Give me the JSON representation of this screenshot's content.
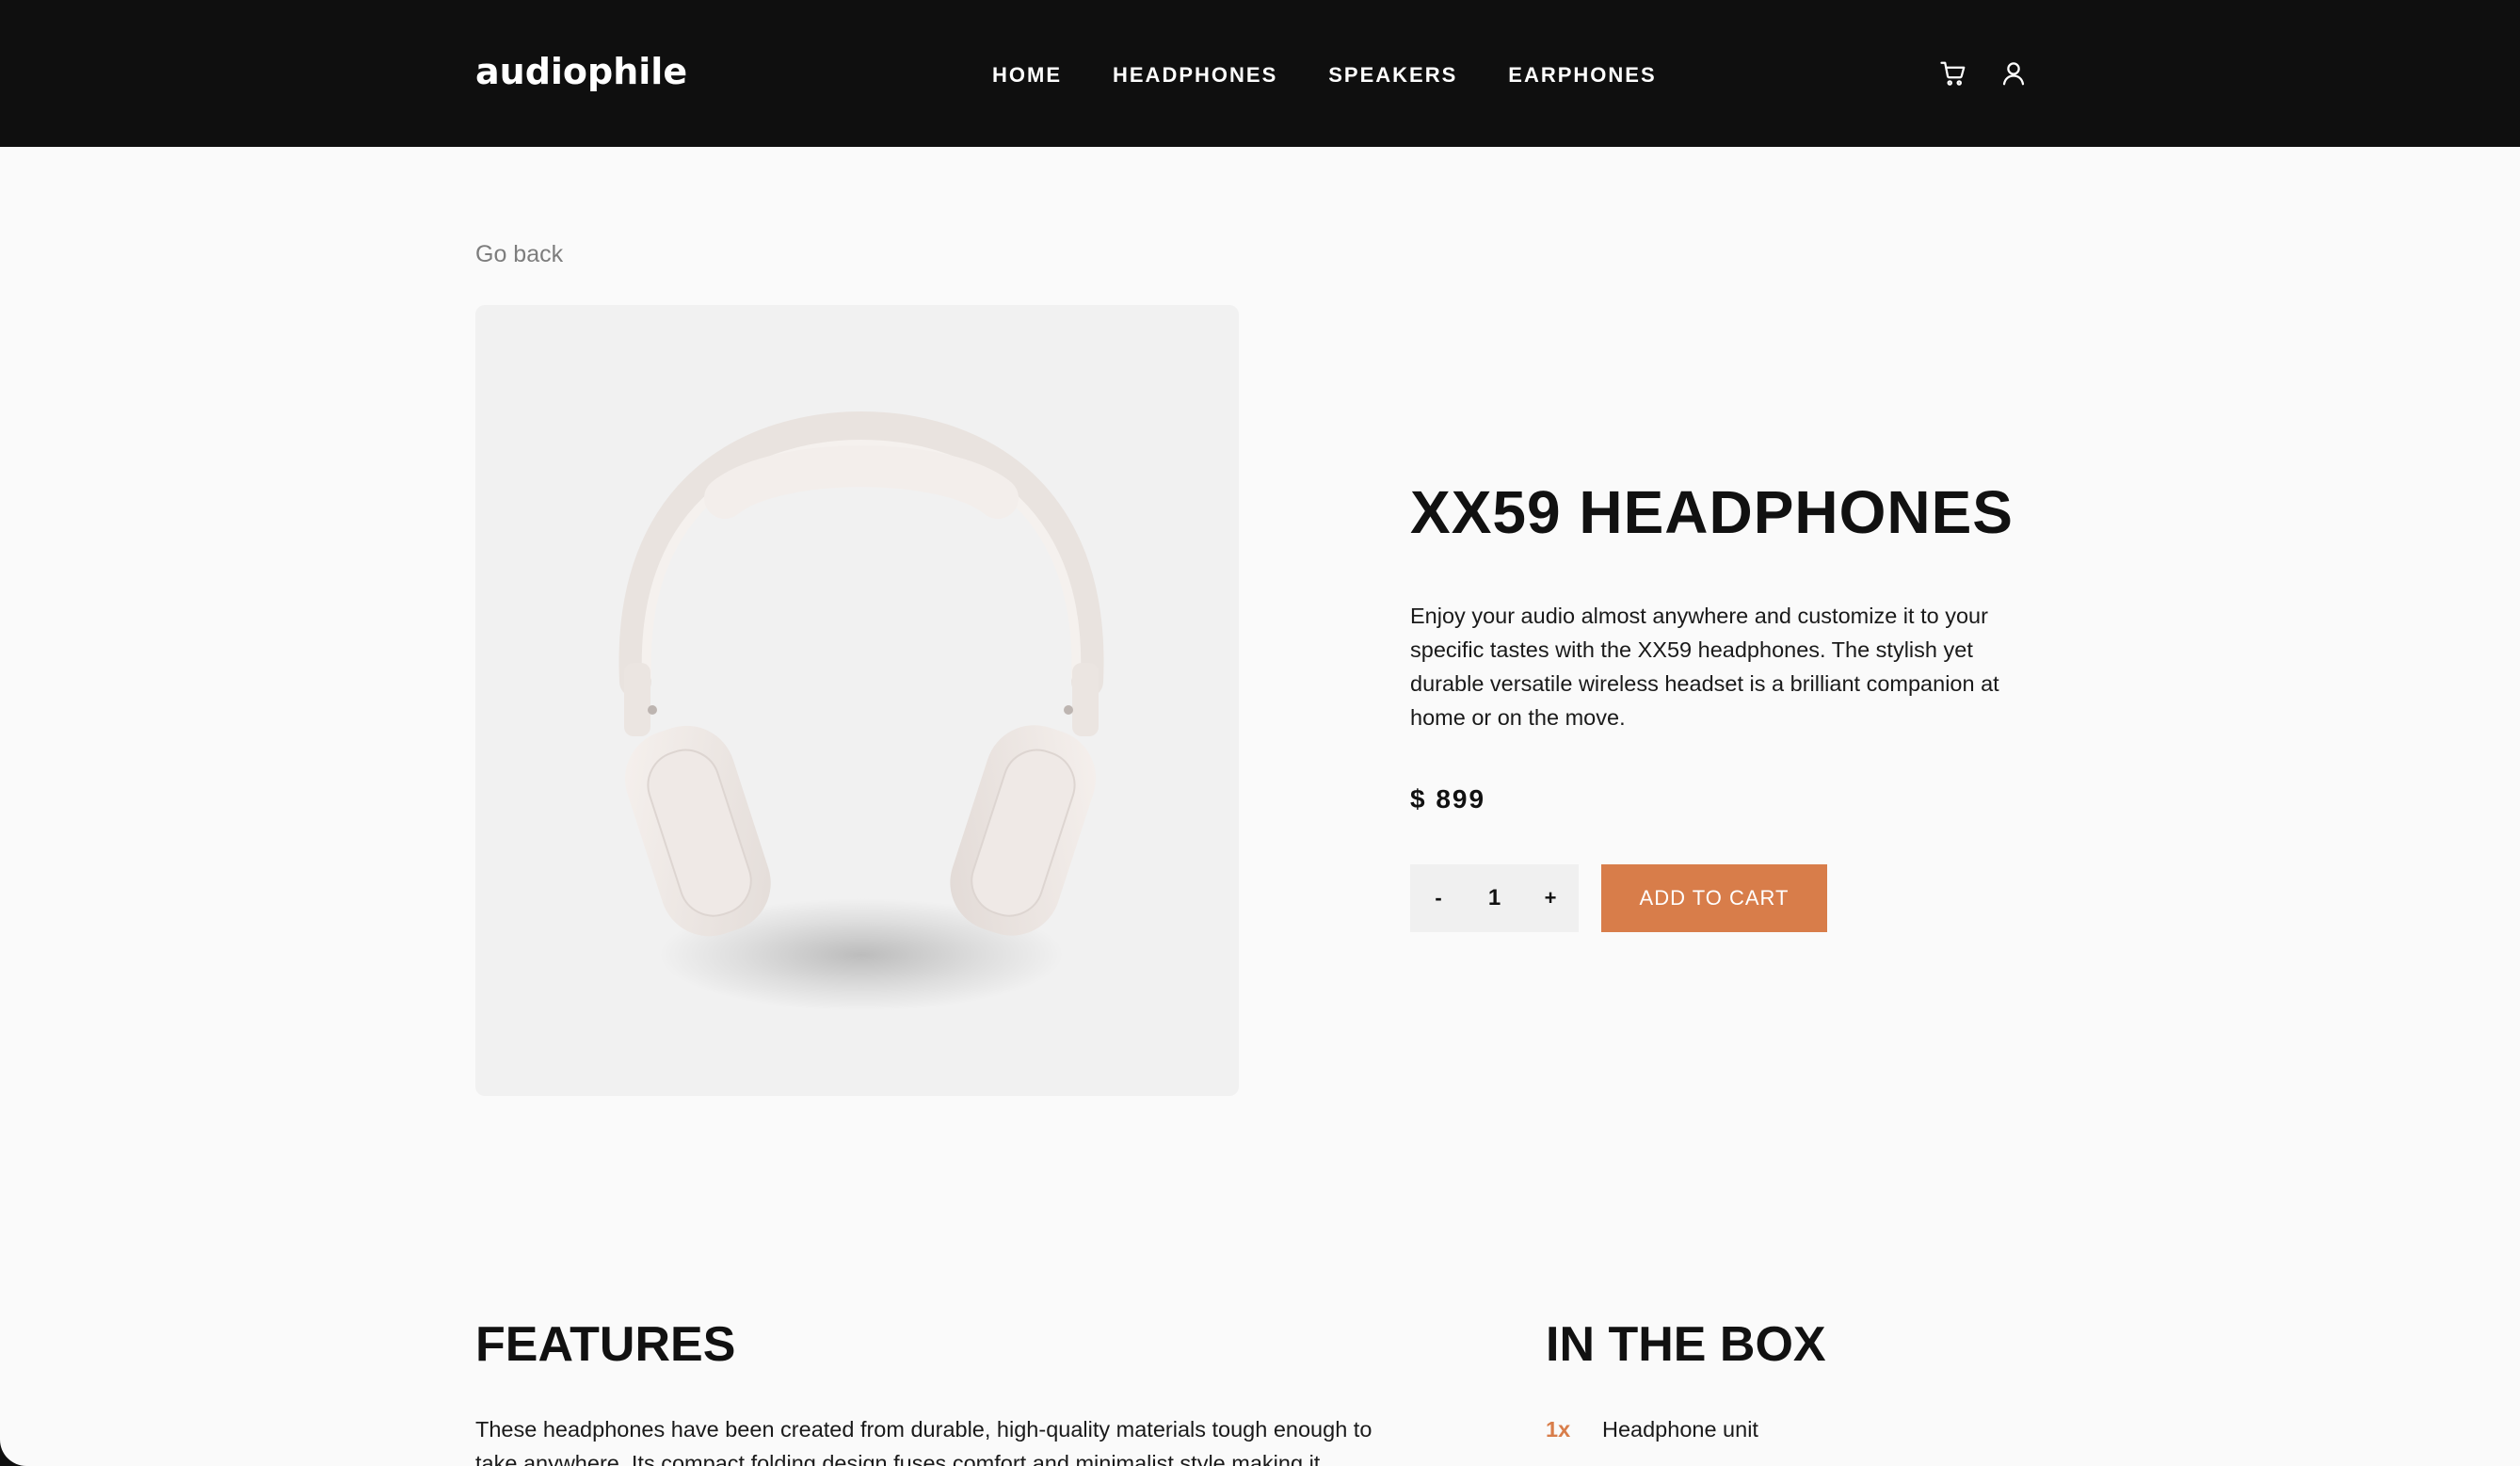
{
  "header": {
    "logo": "audiophile",
    "nav": [
      "HOME",
      "HEADPHONES",
      "SPEAKERS",
      "EARPHONES"
    ],
    "cart_icon": "cart-icon",
    "user_icon": "user-icon"
  },
  "main": {
    "go_back": "Go back",
    "product": {
      "title": "XX59 HEADPHONES",
      "description": "Enjoy your audio almost anywhere and customize it to your specific tastes with the XX59 headphones. The stylish yet durable versatile wireless headset is a brilliant companion at home or on the move.",
      "price": "$ 899",
      "quantity": {
        "minus": "-",
        "value": "1",
        "plus": "+"
      },
      "add_to_cart": "ADD TO CART"
    }
  },
  "features": {
    "title": "FEATURES",
    "text": "These headphones have been created from durable, high-quality materials tough enough to take anywhere. Its compact folding design fuses comfort and minimalist style making it"
  },
  "in_the_box": {
    "title": "IN THE BOX",
    "items": [
      {
        "qty": "1x",
        "name": "Headphone unit"
      }
    ]
  },
  "colors": {
    "accent": "#D87D4A",
    "header_bg": "#0F0F0F",
    "page_bg": "#FAFAFA",
    "image_bg": "#F1F1F1"
  }
}
